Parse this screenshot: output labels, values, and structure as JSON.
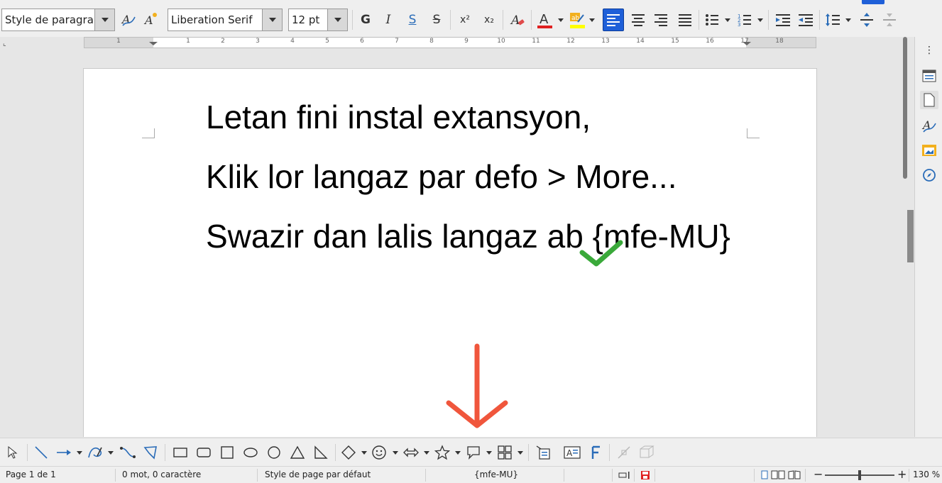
{
  "toolbar": {
    "paragraph_style": "Style de paragraph",
    "font_name": "Liberation Serif",
    "font_size": "12 pt",
    "bold_glyph": "G",
    "italic_glyph": "I",
    "underline_glyph": "S",
    "strike_glyph": "S",
    "superscript_glyph": "x²",
    "subscript_glyph": "x₂"
  },
  "ruler": {
    "corner_glyph": "⌞",
    "ticks": [
      "1",
      "1",
      "2",
      "3",
      "4",
      "5",
      "6",
      "7",
      "8",
      "9",
      "10",
      "11",
      "12",
      "13",
      "14",
      "15",
      "16",
      "17",
      "18"
    ]
  },
  "document": {
    "paragraphs": [
      "Letan fini instal extansyon,",
      "Klik lor langaz par defo > More...",
      "Swazir dan lalis langaz ab {mfe-MU}"
    ]
  },
  "annotations": {
    "checkmark_color": "#3aa93a",
    "arrow_color": "#f0563c"
  },
  "statusbar": {
    "page": "Page 1 de 1",
    "words": "0 mot, 0 caractère",
    "page_style": "Style de page par défaut",
    "language": "{mfe-MU}",
    "zoom": "130 %"
  },
  "colors": {
    "accent": "#1e5fd8",
    "font_color_underline": "#e02020",
    "highlight_underline": "#ffff00"
  }
}
